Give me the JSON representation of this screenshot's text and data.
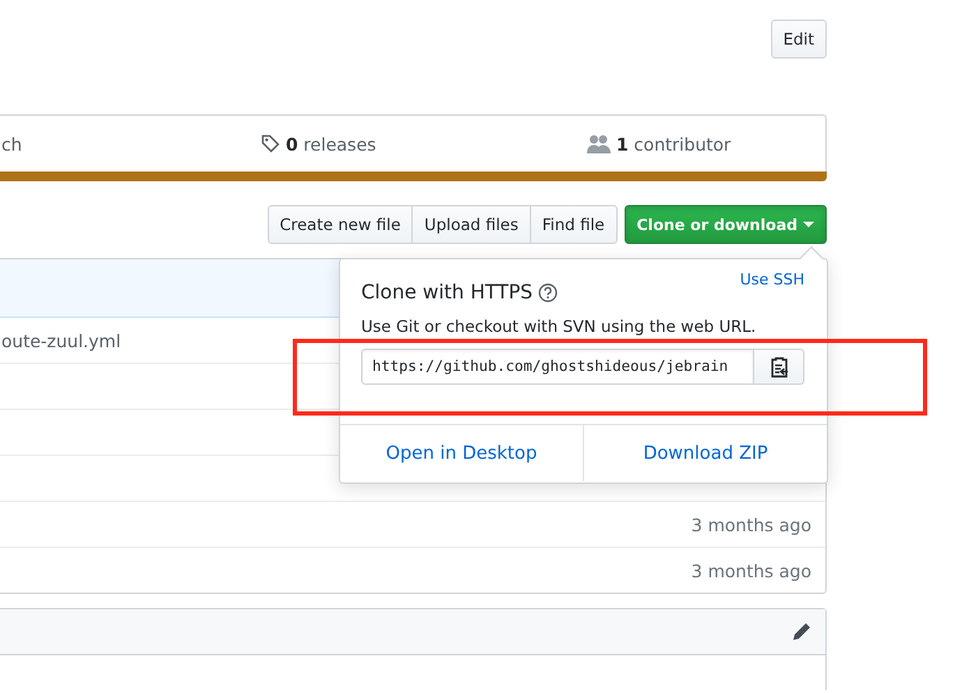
{
  "header": {
    "edit_button": "Edit"
  },
  "stats": [
    {
      "kind": "text",
      "label": "ch"
    },
    {
      "kind": "releases",
      "count": "0",
      "label": "releases"
    },
    {
      "kind": "contributors",
      "count": "1",
      "label": "contributor"
    }
  ],
  "file_actions": [
    "Create new file",
    "Upload files",
    "Find file"
  ],
  "clone_button": {
    "label": "Clone or download",
    "expanded": true
  },
  "files": [
    {
      "kind": "file",
      "name": "oute-zuul.yml"
    },
    {
      "kind": "blank"
    },
    {
      "kind": "blank"
    },
    {
      "kind": "blank"
    },
    {
      "kind": "dated",
      "age": "3 months ago"
    },
    {
      "kind": "dated",
      "age": "3 months ago"
    }
  ],
  "clone_popup": {
    "title": "Clone with HTTPS",
    "switch_link": "Use SSH",
    "description": "Use Git or checkout with SVN using the web URL.",
    "url": "https://github.com/ghostshideous/jebrain",
    "actions": [
      "Open in Desktop",
      "Download ZIP"
    ]
  },
  "annotations": [
    {
      "kind": "rectangle"
    }
  ]
}
